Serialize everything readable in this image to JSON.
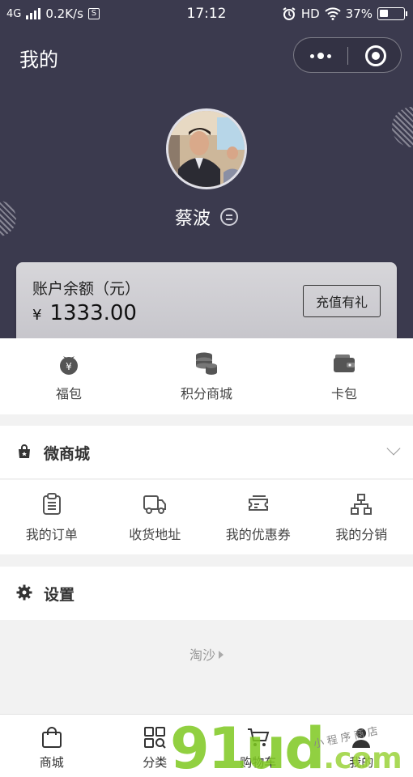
{
  "status_bar": {
    "network": "4G",
    "speed": "0.2K/s",
    "speed_box": "S",
    "time": "17:12",
    "hd": "HD",
    "battery_text": "37%",
    "battery_level": 0.37
  },
  "header": {
    "title": "我的",
    "more_icon": "more-dots-icon",
    "close_icon": "target-circle-icon"
  },
  "profile": {
    "username": "蔡波",
    "switch_icon": "switch-account-icon"
  },
  "balance": {
    "label": "账户余额（元）",
    "currency": "¥",
    "amount": "1333.00",
    "recharge_label": "充值有礼"
  },
  "quick_actions": [
    {
      "label": "福包",
      "icon": "lucky-bag-icon"
    },
    {
      "label": "积分商城",
      "icon": "coins-stack-icon"
    },
    {
      "label": "卡包",
      "icon": "wallet-icon"
    }
  ],
  "mall": {
    "title": "微商城",
    "icon": "shop-bag-icon",
    "items": [
      {
        "label": "我的订单",
        "icon": "clipboard-icon"
      },
      {
        "label": "收货地址",
        "icon": "truck-icon"
      },
      {
        "label": "我的优惠券",
        "icon": "coupon-icon"
      },
      {
        "label": "我的分销",
        "icon": "hierarchy-icon"
      }
    ]
  },
  "settings": {
    "title": "设置",
    "icon": "gear-icon"
  },
  "footer": {
    "link": "淘沙"
  },
  "tabbar": [
    {
      "label": "商城",
      "icon": "shopping-bag-icon"
    },
    {
      "label": "分类",
      "icon": "category-grid-icon"
    },
    {
      "label": "购物车",
      "icon": "cart-icon"
    },
    {
      "label": "我的",
      "icon": "person-icon"
    }
  ],
  "watermark": {
    "main": "91ud",
    "suffix": ".com",
    "sub": "小程序商店"
  },
  "colors": {
    "header_bg": "#3b3a4e",
    "page_bg": "#f2f2f2",
    "watermark_green": "#7ec820"
  }
}
